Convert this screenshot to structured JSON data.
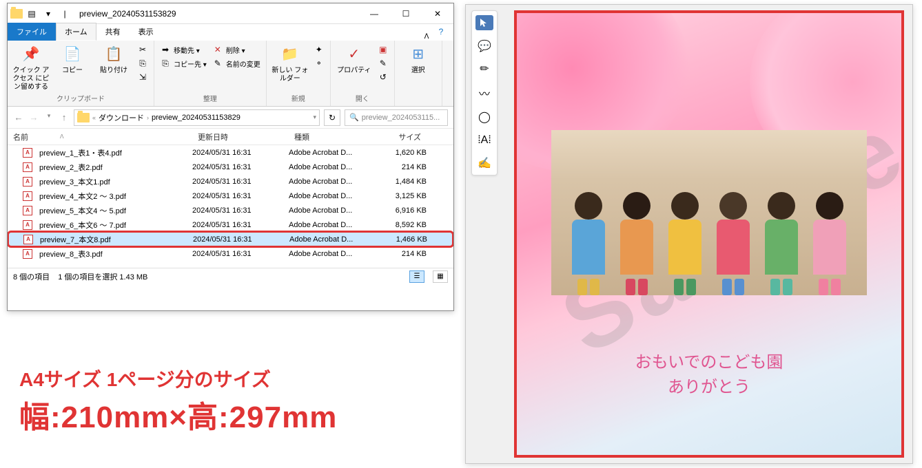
{
  "explorer": {
    "title": "preview_20240531153829",
    "tabs": {
      "file": "ファイル",
      "home": "ホーム",
      "share": "共有",
      "view": "表示"
    },
    "ribbon": {
      "clipboard": {
        "pin": "クイック アクセス\nにピン留めする",
        "copy": "コピー",
        "paste": "貼り付け",
        "copypath": "コピー先 ▾",
        "label": "クリップボード"
      },
      "organize": {
        "moveto": "移動先 ▾",
        "delete": "削除 ▾",
        "copyto": "コピー先 ▾",
        "rename": "名前の変更",
        "label": "整理"
      },
      "new": {
        "newfolder": "新しい\nフォルダー",
        "label": "新規"
      },
      "open": {
        "properties": "プロパティ",
        "label": "開く"
      },
      "select": {
        "select": "選択",
        "label": ""
      }
    },
    "address": {
      "downloads": "ダウンロード",
      "folder": "preview_20240531153829"
    },
    "search_placeholder": "preview_2024053115...",
    "columns": {
      "name": "名前",
      "date": "更新日時",
      "type": "種類",
      "size": "サイズ"
    },
    "files": [
      {
        "name": "preview_1_表1・表4.pdf",
        "date": "2024/05/31 16:31",
        "type": "Adobe Acrobat D...",
        "size": "1,620 KB"
      },
      {
        "name": "preview_2_表2.pdf",
        "date": "2024/05/31 16:31",
        "type": "Adobe Acrobat D...",
        "size": "214 KB"
      },
      {
        "name": "preview_3_本文1.pdf",
        "date": "2024/05/31 16:31",
        "type": "Adobe Acrobat D...",
        "size": "1,484 KB"
      },
      {
        "name": "preview_4_本文2 ～ 3.pdf",
        "date": "2024/05/31 16:31",
        "type": "Adobe Acrobat D...",
        "size": "3,125 KB"
      },
      {
        "name": "preview_5_本文4 ～ 5.pdf",
        "date": "2024/05/31 16:31",
        "type": "Adobe Acrobat D...",
        "size": "6,916 KB"
      },
      {
        "name": "preview_6_本文6 ～ 7.pdf",
        "date": "2024/05/31 16:31",
        "type": "Adobe Acrobat D...",
        "size": "8,592 KB"
      },
      {
        "name": "preview_7_本文8.pdf",
        "date": "2024/05/31 16:31",
        "type": "Adobe Acrobat D...",
        "size": "1,466 KB",
        "selected": true,
        "highlighted": true
      },
      {
        "name": "preview_8_表3.pdf",
        "date": "2024/05/31 16:31",
        "type": "Adobe Acrobat D...",
        "size": "214 KB"
      }
    ],
    "status": {
      "count": "8 個の項目",
      "selection": "1 個の項目を選択  1.43 MB"
    }
  },
  "pdf": {
    "watermark": "Sample",
    "caption1": "おもいでのこども園",
    "caption2": "ありがとう",
    "kids": [
      {
        "head": "#3a2a1c",
        "body": "#5aa5d8",
        "boot": "#e0b848"
      },
      {
        "head": "#2a1c14",
        "body": "#e89850",
        "boot": "#d84860"
      },
      {
        "head": "#3a2a1c",
        "body": "#f0c040",
        "boot": "#4a9860"
      },
      {
        "head": "#4a3828",
        "body": "#e85a70",
        "boot": "#5890d0"
      },
      {
        "head": "#3a2a1c",
        "body": "#68b068",
        "boot": "#58b8a0"
      },
      {
        "head": "#2a1c14",
        "body": "#f0a0b8",
        "boot": "#f080a0"
      }
    ]
  },
  "annotation": {
    "line1": "A4サイズ 1ページ分のサイズ",
    "line2": "幅:210mm×高:297mm"
  }
}
